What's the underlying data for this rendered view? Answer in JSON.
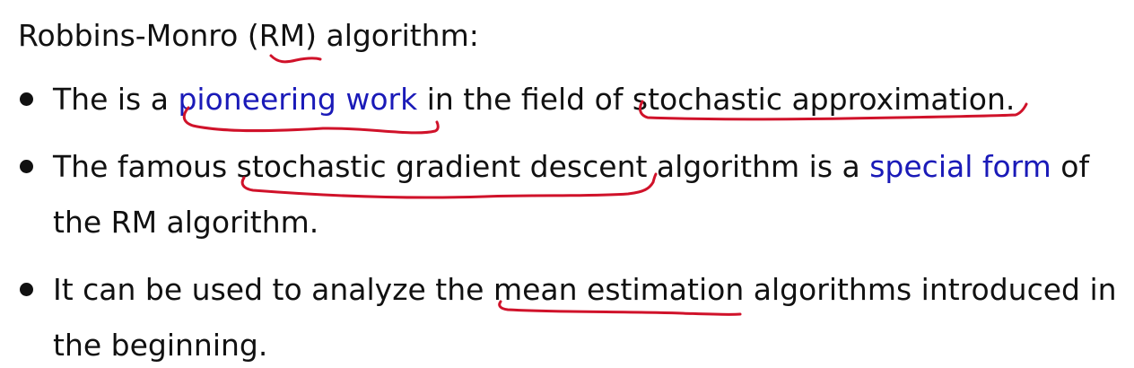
{
  "heading": {
    "before": "Robbins-Monro (",
    "acronym": "RM",
    "after": ") algorithm:"
  },
  "bullets": [
    {
      "p1": "The is a ",
      "link": "pioneering work",
      "p2": " in the field of ",
      "emph": "stochastic approximation."
    },
    {
      "p1": "The famous ",
      "emph": "stochastic gradient descent",
      "p2": " algorithm is a ",
      "link": "special form",
      "p3": " of",
      "line2": "the RM algorithm."
    },
    {
      "p1": "It can be used to analyze the ",
      "emph": "mean estimation",
      "p2": " algorithms introduced in",
      "line2": "the beginning."
    }
  ],
  "colors": {
    "text": "#111111",
    "highlight_blue": "#1a1ab8",
    "annotation_red": "#d0122a"
  }
}
